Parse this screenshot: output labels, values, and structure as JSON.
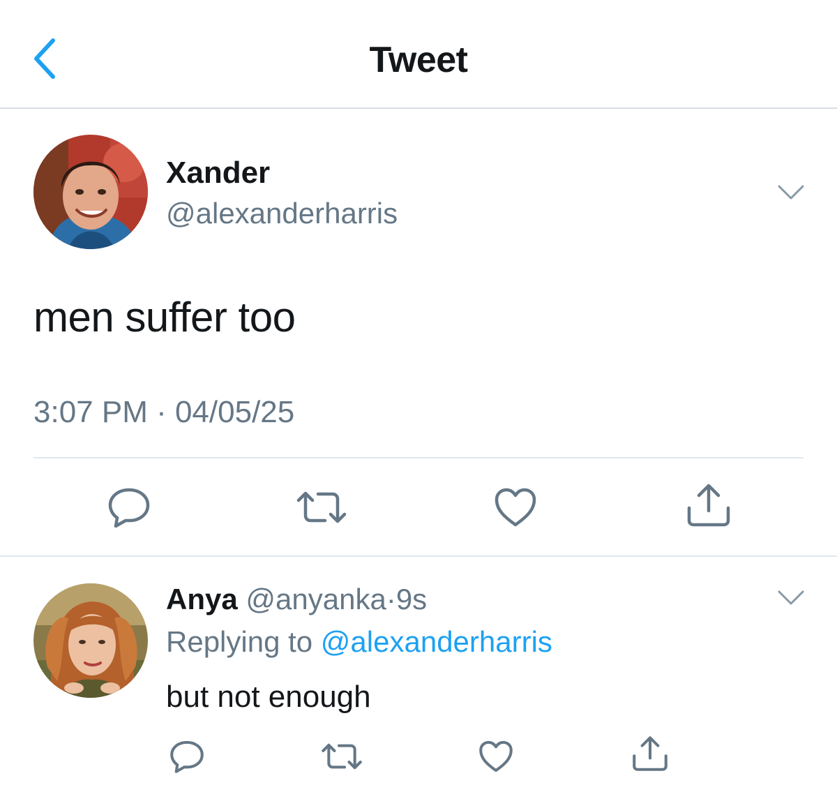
{
  "header": {
    "title": "Tweet",
    "back_icon": "chevron-left-icon",
    "accent_color": "#1da1f2"
  },
  "main_tweet": {
    "author_name": "Xander",
    "author_handle": "@alexanderharris",
    "text": "men suffer too",
    "timestamp": "3:07 PM · 04/05/25",
    "menu_icon": "chevron-down-icon",
    "actions": [
      "reply-icon",
      "retweet-icon",
      "like-icon",
      "share-icon"
    ]
  },
  "reply": {
    "author_name": "Anya",
    "author_handle": "@anyanka",
    "separator": "·",
    "age": "9s",
    "replying_prefix": "Replying to",
    "replying_to": "@alexanderharris",
    "text": "but not enough",
    "menu_icon": "chevron-down-icon",
    "actions": [
      "reply-icon",
      "retweet-icon",
      "like-icon",
      "share-icon"
    ]
  },
  "colors": {
    "text_primary": "#14171a",
    "text_secondary": "#657786",
    "link": "#1da1f2",
    "divider": "#e1e8ed"
  }
}
